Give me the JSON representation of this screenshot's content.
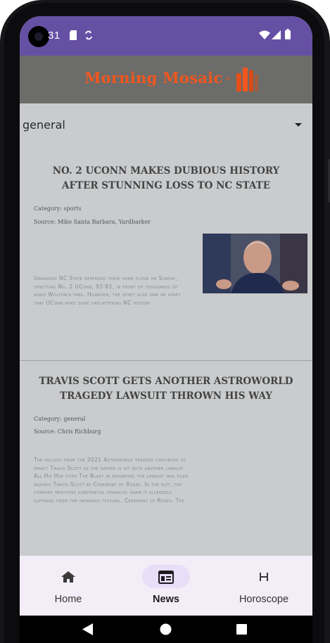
{
  "status_bar": {
    "time": "31",
    "left_icons": [
      "sd-card-icon",
      "sync-icon"
    ],
    "right_icons": [
      "wifi-icon",
      "signal-icon",
      "battery-icon"
    ]
  },
  "header": {
    "logo_text": "Morning Mosaic",
    "logo_suffix": "TM",
    "colors": {
      "background": "#6c6c6a",
      "logo": "#f2561d"
    }
  },
  "category_dropdown": {
    "selected": "general"
  },
  "articles": [
    {
      "title": "NO. 2 UCONN MAKES DUBIOUS HISTORY AFTER STUNNING LOSS TO NC STATE",
      "category": "Category: sports",
      "source": "Source: Mike Santa Barbara, Yardbarker",
      "summary": "Unranked NC State defended their home floor on Sunday, upsetting No. 2 UConn, 92-81, in front of thousands of rabid Wolfpack fans. However, the upset also saw an upset that UConn make some unflattering NC history",
      "has_image": true
    },
    {
      "title": "TRAVIS SCOTT GETS ANOTHER ASTROWORLD TRAGEDY LAWSUIT THROWN HIS WAY",
      "category": "Category: general",
      "source": "Source: Chris Richburg",
      "summary": "The fallout from the 2021 Astroworld tragedy continues to impact Travis Scott as the rapper is hit with another lawsuit. All Hip Hop cites The Blast in reporting the lawsuit was filed against Travis Scott by Ceremony of Roses. In the suit, the company mentions substantial financial harm it allegedly suffered from the infamous festival. Ceremony of Roses. The",
      "has_image": false
    }
  ],
  "bottom_nav": {
    "items": [
      {
        "label": "Home",
        "icon": "home-icon",
        "active": false
      },
      {
        "label": "News",
        "icon": "newspaper-icon",
        "active": true
      },
      {
        "label": "Horoscope",
        "icon": "h-letter-icon",
        "active": false
      }
    ]
  },
  "system_nav": {
    "icons": [
      "back-icon",
      "home-circle-icon",
      "recents-icon"
    ]
  },
  "colors": {
    "accent": "#6650a4",
    "content_bg": "#c9cbcd",
    "nav_active_pill": "#e8def8"
  }
}
